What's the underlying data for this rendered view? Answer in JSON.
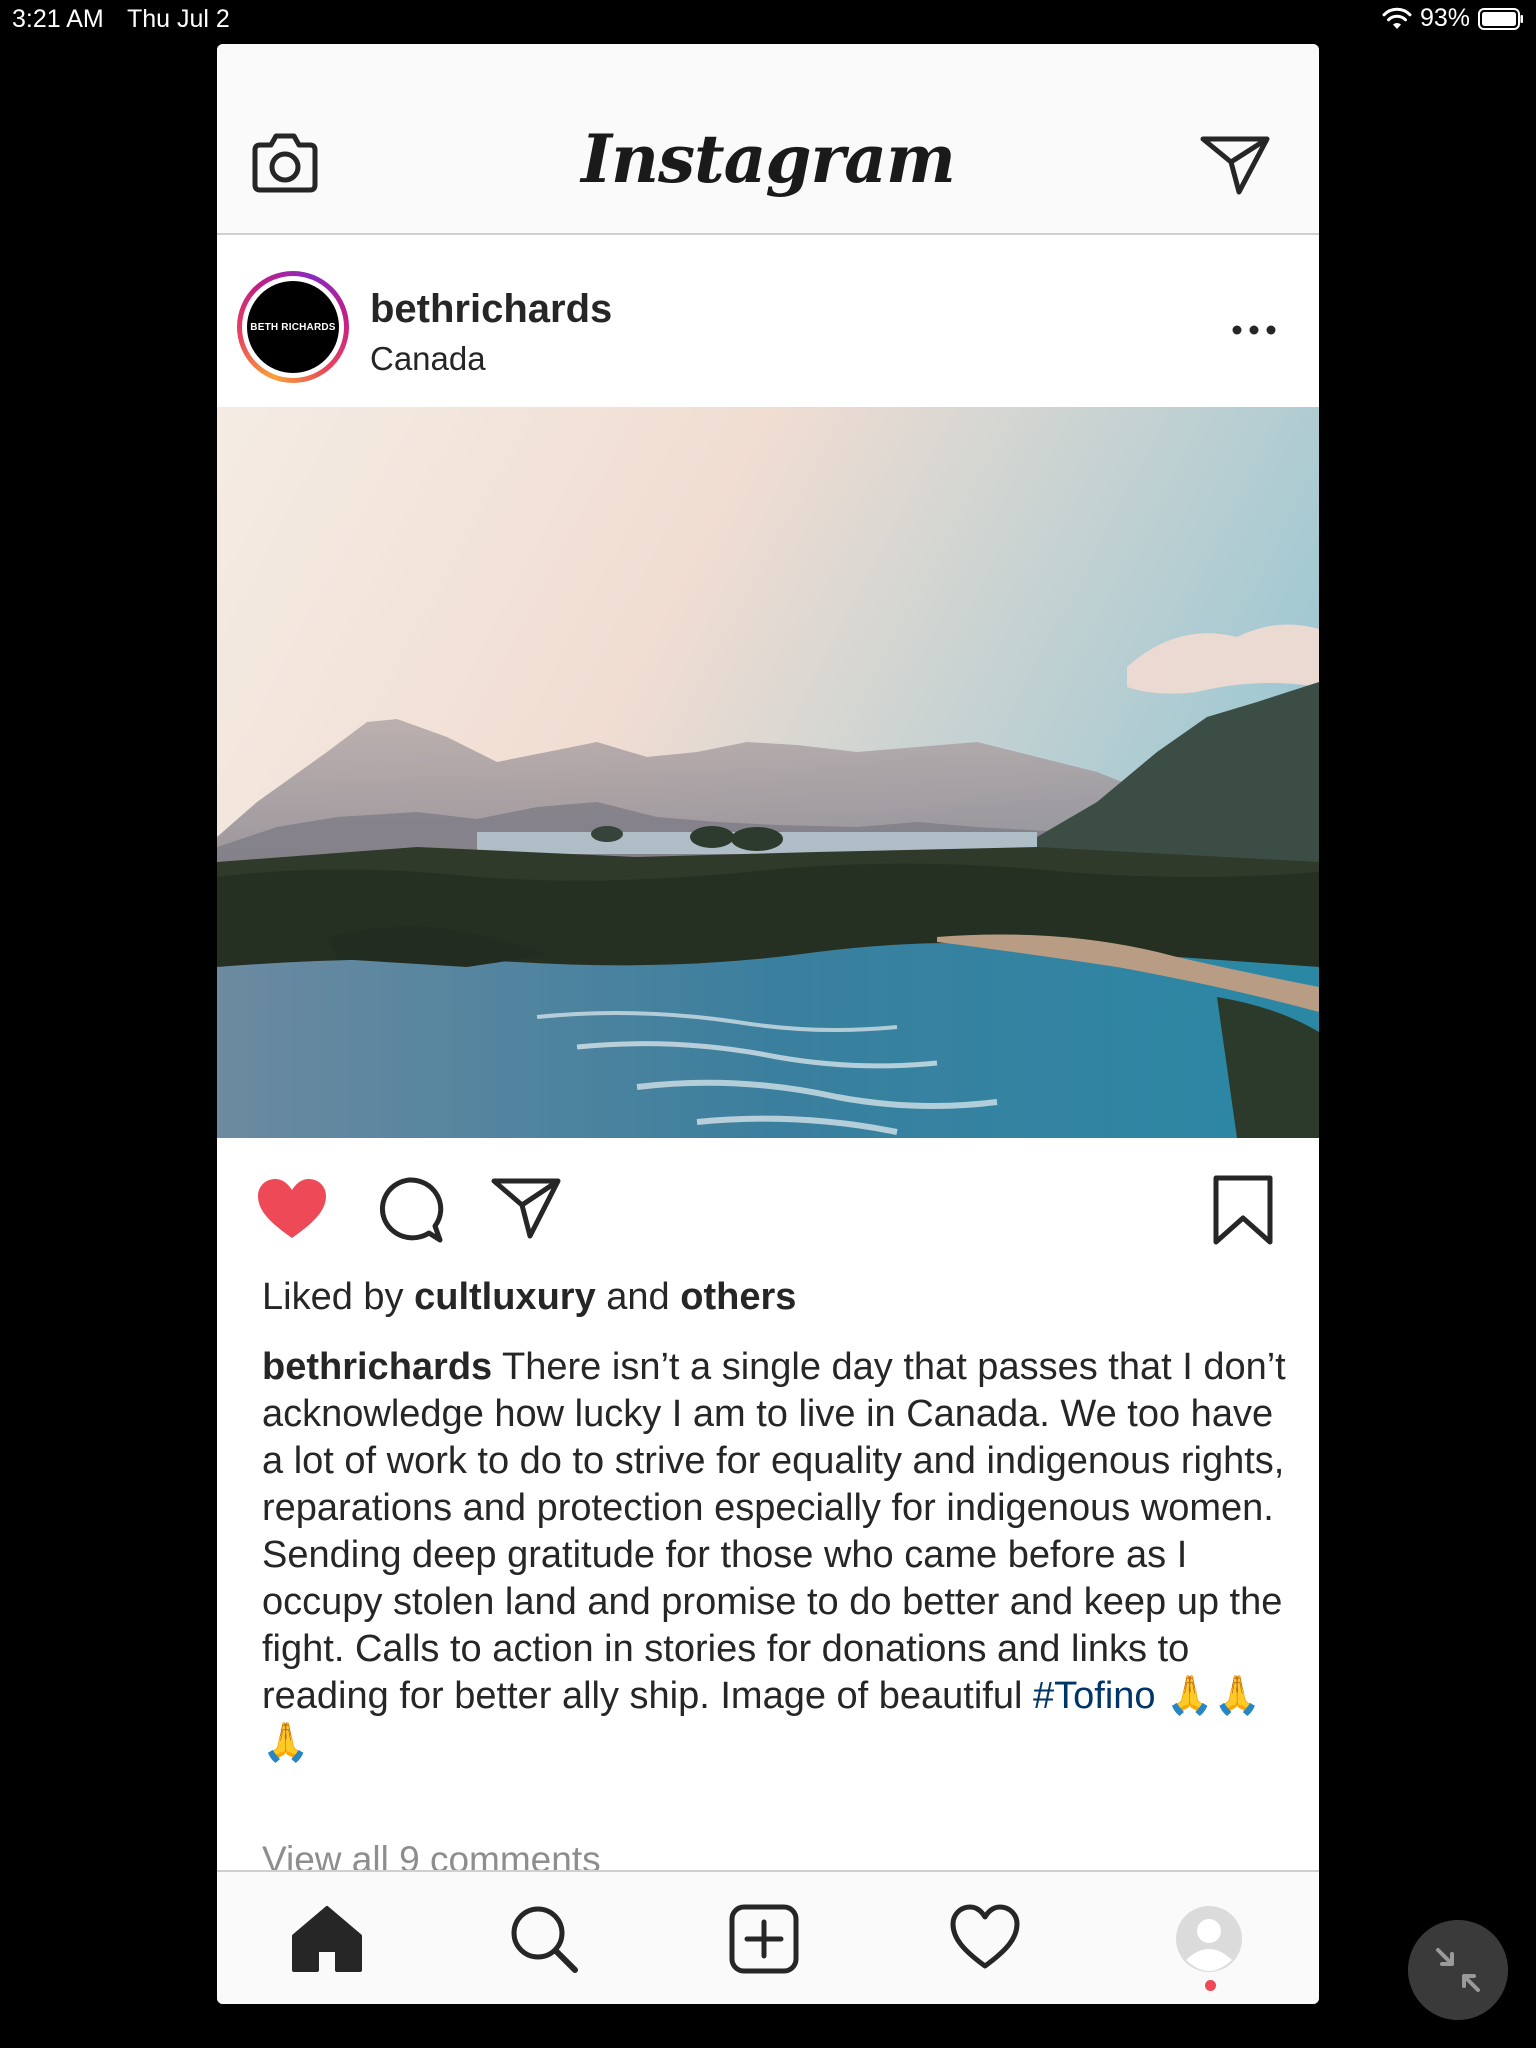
{
  "status_bar": {
    "time": "3:21 AM",
    "date": "Thu Jul 2",
    "battery": "93%"
  },
  "header": {
    "brand": "Instagram",
    "left_icon": "camera-icon",
    "right_icon": "direct-message-icon"
  },
  "post": {
    "avatar_text": "BETH RICHARDS",
    "username": "bethrichards",
    "location": "Canada",
    "liked": true,
    "likes": {
      "prefix": "Liked by",
      "user": "cultluxury",
      "joiner": "and",
      "others": "others"
    },
    "caption": {
      "user": "bethrichards",
      "text": "There isn’t a single day that passes that I don’t acknowledge how lucky I am to live in Canada. We too have a lot of work to do to strive for equality and indigenous rights, reparations and protection especially for indigenous women. Sending deep gratitude for those who came before as I occupy stolen land and promise to do better and keep up the fight. Calls to action in stories for donations and links to reading for better ally ship. Image of beautiful",
      "hashtag": "#Tofino",
      "emoji": "🙏🙏🙏"
    },
    "view_comments": "View all 9 comments"
  },
  "bottom_nav": [
    {
      "icon": "home-icon",
      "active": true
    },
    {
      "icon": "search-icon"
    },
    {
      "icon": "new-post-icon"
    },
    {
      "icon": "activity-heart-icon"
    },
    {
      "icon": "profile-icon",
      "notification": true
    }
  ],
  "colors": {
    "like_red": "#ED4956",
    "hashtag_blue": "#003569",
    "text": "#262626",
    "muted": "#8E8E8E"
  }
}
